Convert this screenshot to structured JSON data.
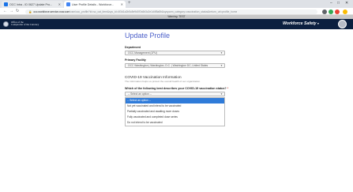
{
  "browser": {
    "tabs": [
      {
        "label": "OCC Intra - ID 0627 Update Pro...",
        "favicon_color": "#1a73e8"
      },
      {
        "label": "User Profile Details - Workforce...",
        "favicon_color": "#4285f4"
      }
    ],
    "new_tab": "+",
    "window_controls": [
      "–",
      "□",
      "✕"
    ],
    "nav": {
      "back": "←",
      "forward": "→",
      "reload": "↻"
    },
    "url_host": "occ.workforce.service-now.com",
    "url_path": "/csm/occ_profile?id=sc_cat_item&sys_id=4f3d1a2b5c8e9d0f7a6b3c2e1d4f5a8b&sysparm_category=vaccination_status&return_url=profile_home",
    "lock_icon": "🔒",
    "extension_colors": [
      "#5f6368",
      "#34a853",
      "#ea4335",
      "#fbbc04"
    ]
  },
  "banner": {
    "text": "Warning: TEST"
  },
  "header": {
    "org_line1": "Office of the",
    "org_line2": "Comptroller of the Currency",
    "app_title": "Workforce Safety",
    "caret": "▾",
    "brand_color": "#0b1f3f"
  },
  "form": {
    "title": "Update Profile",
    "department": {
      "label": "Department",
      "value": "OCC Management (1PU)"
    },
    "primary_facility": {
      "label": "Primary Facility",
      "value": "OCC Washington | Washington, D.C. | Washington DC, United States"
    },
    "section_title": "COVID-19 Vaccination Information",
    "section_desc": "The information helps us protect the overall health of our organization.",
    "question": "Which of the following best describes your COVID-19 vaccination status?",
    "required_mark": "*",
    "current_value": "-- Select an option --",
    "options": [
      "-- Select an option --",
      "Not yet vaccinated and intend to be vaccinated",
      "Partially vaccinated and awaiting more doses",
      "Fully vaccinated and completed dose series",
      "Do not intend to be vaccinated"
    ],
    "selected_option_index": 0,
    "accent_color": "#4b5fc9",
    "highlight_color": "#2f7bd9"
  }
}
